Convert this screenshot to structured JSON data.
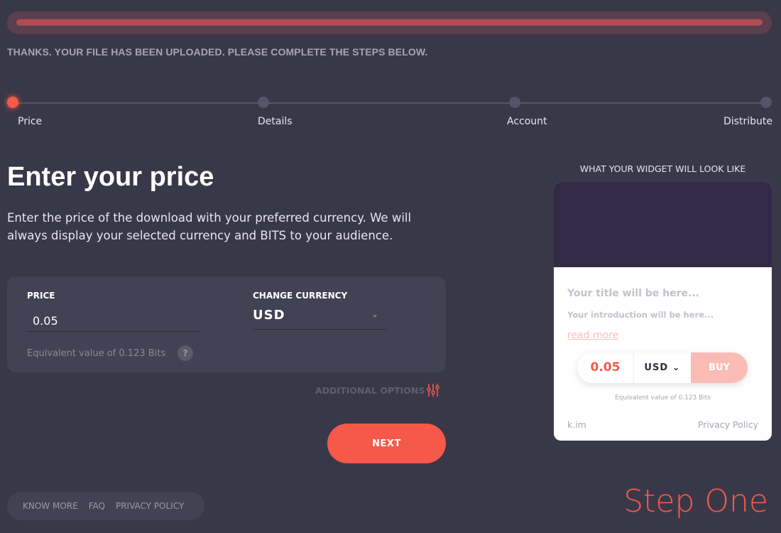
{
  "upload": {
    "progress_percent": 100,
    "message": "THANKS. YOUR FILE HAS BEEN UPLOADED. PLEASE COMPLETE THE STEPS BELOW."
  },
  "steps": [
    {
      "label": "Price",
      "active": true
    },
    {
      "label": "Details",
      "active": false
    },
    {
      "label": "Account",
      "active": false
    },
    {
      "label": "Distribute",
      "active": false
    }
  ],
  "main": {
    "title": "Enter your price",
    "intro": "Enter the price of the download with your preferred currency. We will always display your selected currency and BITS to your audience.",
    "price_label": "PRICE",
    "price_value": "0.05",
    "currency_label": "CHANGE CURRENCY",
    "currency_value": "USD",
    "equivalent": "Equivalent value of 0.123 Bits",
    "help": "?",
    "additional_options": "ADDITIONAL OPTIONS",
    "next": "NEXT"
  },
  "footer": {
    "links": [
      "KNOW MORE",
      "FAQ",
      "PRIVACY POLICY"
    ]
  },
  "step_caption": "Step One",
  "widget": {
    "heading": "WHAT YOUR WIDGET WILL LOOK LIKE",
    "title": "Your title will be here...",
    "intro": "Your introduction will be here...",
    "read_more": "read more",
    "price": "0.05",
    "currency": "USD",
    "buy": "BUY",
    "equivalent": "Equivalent value of 0.123 Bits",
    "brand": "k.im",
    "privacy": "Privacy Policy"
  },
  "colors": {
    "accent": "#f5594a",
    "background": "#393849",
    "card": "#434254"
  }
}
